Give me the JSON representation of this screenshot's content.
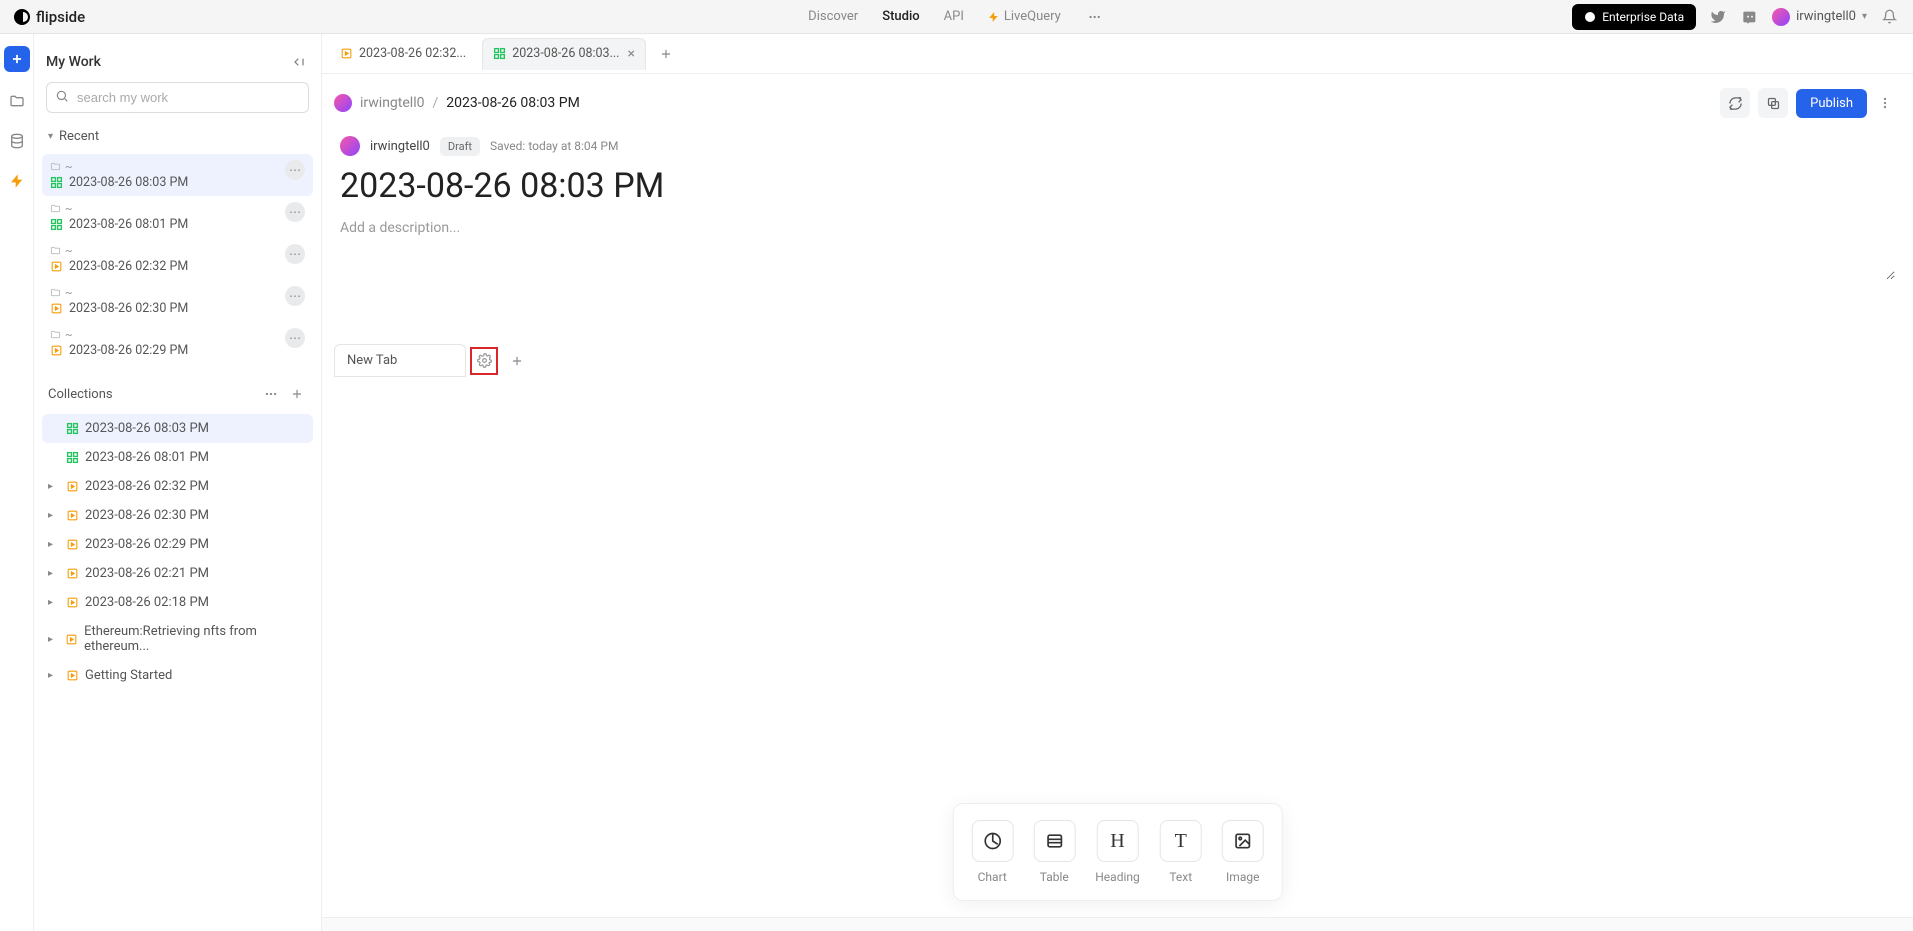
{
  "brand": "flipside",
  "nav": {
    "discover": "Discover",
    "studio": "Studio",
    "api": "API",
    "livequery": "LiveQuery"
  },
  "enterprise": "Enterprise Data",
  "user": "irwingtell0",
  "sidebar": {
    "title": "My Work",
    "search_placeholder": "search my work",
    "recent_label": "Recent",
    "collections_label": "Collections",
    "recent": [
      {
        "path": "~",
        "name": "2023-08-26 08:03 PM",
        "type": "dash"
      },
      {
        "path": "~",
        "name": "2023-08-26 08:01 PM",
        "type": "dash"
      },
      {
        "path": "~",
        "name": "2023-08-26 02:32 PM",
        "type": "folder"
      },
      {
        "path": "~",
        "name": "2023-08-26 02:30 PM",
        "type": "folder"
      },
      {
        "path": "~",
        "name": "2023-08-26 02:29 PM",
        "type": "folder"
      }
    ],
    "collections": [
      {
        "name": "2023-08-26 08:03 PM",
        "type": "dash",
        "chev": false,
        "active": true
      },
      {
        "name": "2023-08-26 08:01 PM",
        "type": "dash",
        "chev": false
      },
      {
        "name": "2023-08-26 02:32 PM",
        "type": "folder",
        "chev": true
      },
      {
        "name": "2023-08-26 02:30 PM",
        "type": "folder",
        "chev": true
      },
      {
        "name": "2023-08-26 02:29 PM",
        "type": "folder",
        "chev": true
      },
      {
        "name": "2023-08-26 02:21 PM",
        "type": "folder",
        "chev": true
      },
      {
        "name": "2023-08-26 02:18 PM",
        "type": "folder",
        "chev": true
      },
      {
        "name": "Ethereum:Retrieving nfts from ethereum...",
        "type": "folder",
        "chev": true
      },
      {
        "name": "Getting Started",
        "type": "folder",
        "chev": true
      }
    ]
  },
  "tabs": [
    {
      "name": "2023-08-26 02:32...",
      "type": "folder"
    },
    {
      "name": "2023-08-26 08:03...",
      "type": "dash",
      "active": true
    }
  ],
  "breadcrumb": {
    "user": "irwingtell0",
    "sep": "/",
    "title": "2023-08-26 08:03 PM"
  },
  "publish": "Publish",
  "doc": {
    "user": "irwingtell0",
    "draft": "Draft",
    "saved": "Saved: today at 8:04 PM",
    "title": "2023-08-26 08:03 PM",
    "desc_placeholder": "Add a description..."
  },
  "inner_tab": "New Tab",
  "widgets": {
    "chart": "Chart",
    "table": "Table",
    "heading": "Heading",
    "text": "Text",
    "image": "Image"
  }
}
